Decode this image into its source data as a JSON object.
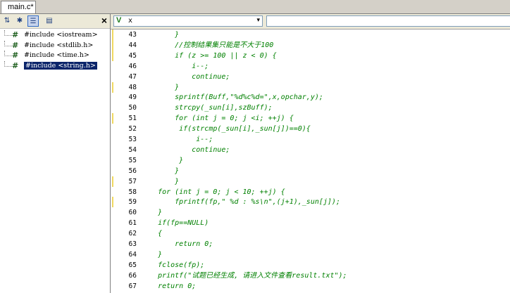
{
  "tabs": [
    {
      "label": "main.c*"
    }
  ],
  "left_panel": {
    "close_label": "×",
    "tree": [
      {
        "label": "#include <iostream>",
        "selected": false
      },
      {
        "label": "#include <stdlib.h>",
        "selected": false
      },
      {
        "label": "#include <time.h>",
        "selected": false
      },
      {
        "label": "#include <string.h>",
        "selected": true
      }
    ]
  },
  "toolbar": {
    "symbol_combo_value": "x",
    "combo_arrow": "▾"
  },
  "code": {
    "text_color": "#008000",
    "change_marker_color": "#f0d860",
    "lines": [
      {
        "num": "43",
        "text": "        }",
        "marked": true
      },
      {
        "num": "44",
        "text": "        //控制结果集只能是不大于100",
        "marked": true
      },
      {
        "num": "45",
        "text": "        if (z >= 100 || z < 0) {",
        "marked": true
      },
      {
        "num": "46",
        "text": "            i--;",
        "marked": false
      },
      {
        "num": "47",
        "text": "            continue;",
        "marked": false
      },
      {
        "num": "48",
        "text": "        }",
        "marked": true
      },
      {
        "num": "49",
        "text": "        sprintf(Buff,\"%d%c%d=\",x,opchar,y);",
        "marked": false
      },
      {
        "num": "50",
        "text": "        strcpy(_sun[i],szBuff);",
        "marked": false
      },
      {
        "num": "51",
        "text": "        for (int j = 0; j <i; ++j) {",
        "marked": true
      },
      {
        "num": "52",
        "text": "         if(strcmp(_sun[i],_sun[j])==0){",
        "marked": false
      },
      {
        "num": "53",
        "text": "             i--;",
        "marked": false
      },
      {
        "num": "54",
        "text": "            continue;",
        "marked": false
      },
      {
        "num": "55",
        "text": "         }",
        "marked": false
      },
      {
        "num": "56",
        "text": "        }",
        "marked": false
      },
      {
        "num": "57",
        "text": "        }",
        "marked": true
      },
      {
        "num": "58",
        "text": "    for (int j = 0; j < 10; ++j) {",
        "marked": false
      },
      {
        "num": "59",
        "text": "        fprintf(fp,\" %d : %s\\n\",(j+1),_sun[j]);",
        "marked": true
      },
      {
        "num": "60",
        "text": "    }",
        "marked": false
      },
      {
        "num": "61",
        "text": "    if(fp==NULL)",
        "marked": false
      },
      {
        "num": "62",
        "text": "    {",
        "marked": false
      },
      {
        "num": "63",
        "text": "        return 0;",
        "marked": false
      },
      {
        "num": "64",
        "text": "    }",
        "marked": false
      },
      {
        "num": "65",
        "text": "    fclose(fp);",
        "marked": false
      },
      {
        "num": "66",
        "text": "    printf(\"试题已经生成, 请进入文件查看result.txt\");",
        "marked": false
      },
      {
        "num": "67",
        "text": "    return 0;",
        "marked": false
      }
    ]
  }
}
